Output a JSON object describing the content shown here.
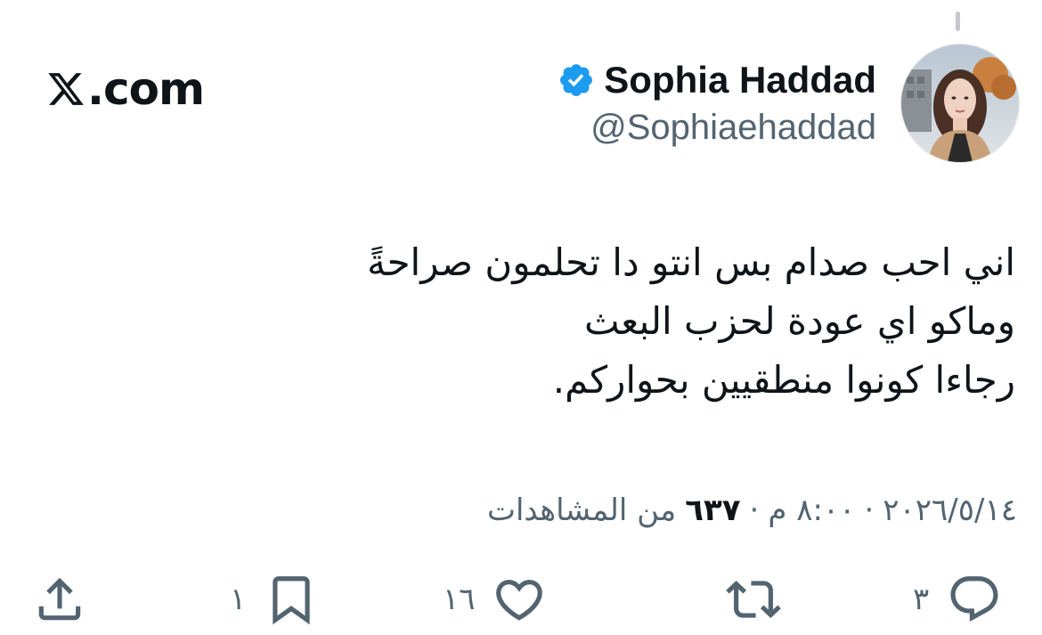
{
  "brand": {
    "label": ".com"
  },
  "author": {
    "name": "Sophia Haddad",
    "handle": "@Sophiaehaddad",
    "verified": true
  },
  "tweet": {
    "lines": [
      "اني احب صدام بس انتو دا تحلمون صراحةً",
      "وماكو اي عودة لحزب البعث",
      "رجاءا كونوا منطقيين بحواركم."
    ]
  },
  "meta": {
    "date": "٢٠٢٦/٥/١٤",
    "separator": "·",
    "time": "٨:٠٠ م",
    "views_count": "٦٣٧",
    "views_label": "من المشاهدات"
  },
  "actions": {
    "reply_count": "٣",
    "repost_count": "",
    "like_count": "١٦",
    "bookmark_count": "١",
    "share_count": ""
  },
  "colors": {
    "text": "#0f1419",
    "secondary": "#536471",
    "verified_blue": "#1d9bf0"
  },
  "icons": [
    "x-logo-icon",
    "verified-badge-icon",
    "reply-icon",
    "repost-icon",
    "like-icon",
    "bookmark-icon",
    "share-icon"
  ]
}
